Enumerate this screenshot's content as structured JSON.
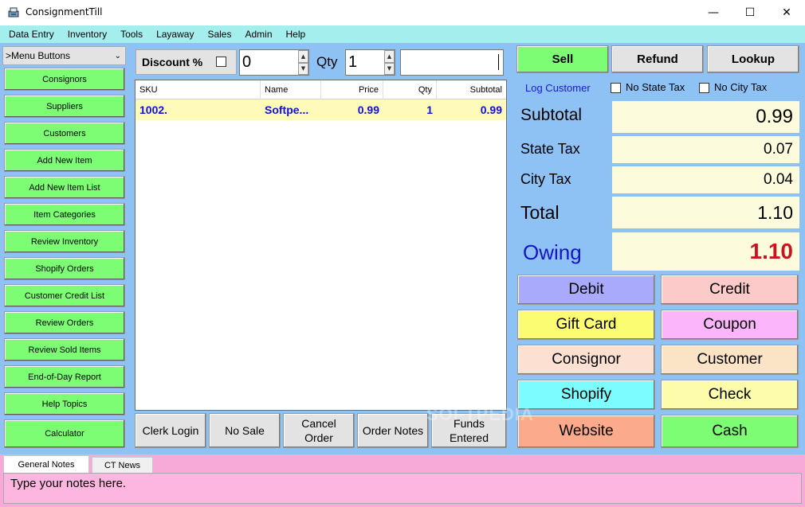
{
  "window": {
    "title": "ConsignmentTill",
    "minimize": "—",
    "maximize": "☐",
    "close": "✕"
  },
  "menu": [
    "Data Entry",
    "Inventory",
    "Tools",
    "Layaway",
    "Sales",
    "Admin",
    "Help"
  ],
  "left": {
    "dropdown_label": ">Menu Buttons",
    "buttons": [
      "Consignors",
      "Suppliers",
      "Customers",
      "Add New Item",
      "Add New Item List",
      "Item Categories",
      "Review Inventory",
      "Shopify Orders",
      "Customer Credit List",
      "Review Orders",
      "Review Sold Items",
      "End-of-Day Report",
      "Help Topics",
      "Calculator"
    ],
    "button_color": "#7dfd74"
  },
  "center": {
    "discount_label": "Discount %",
    "discount_value": "0",
    "qty_label": "Qty",
    "qty_value": "1",
    "grid": {
      "headers": [
        "SKU",
        "Name",
        "Price",
        "Qty",
        "Subtotal"
      ],
      "rows": [
        {
          "sku": "1002.",
          "name": "Softpe...",
          "price": "0.99",
          "qty": "1",
          "subtotal": "0.99"
        }
      ]
    },
    "bottom_buttons": [
      "Clerk Login",
      "No Sale",
      "Cancel Order",
      "Order Notes",
      "Funds Entered"
    ]
  },
  "right": {
    "sell": "Sell",
    "refund": "Refund",
    "lookup": "Lookup",
    "log_customer": "Log Customer",
    "no_state_tax": "No State Tax",
    "no_city_tax": "No City Tax",
    "subtotal_label": "Subtotal",
    "subtotal_value": "0.99",
    "state_tax_label": "State Tax",
    "state_tax_value": "0.07",
    "city_tax_label": "City Tax",
    "city_tax_value": "0.04",
    "total_label": "Total",
    "total_value": "1.10",
    "owing_label": "Owing",
    "owing_value": "1.10",
    "payments": [
      {
        "label": "Debit",
        "color": "#aaaafc"
      },
      {
        "label": "Credit",
        "color": "#fdcaca"
      },
      {
        "label": "Gift Card",
        "color": "#fcfc72"
      },
      {
        "label": "Coupon",
        "color": "#fbb5fb"
      },
      {
        "label": "Consignor",
        "color": "#fce0d2"
      },
      {
        "label": "Customer",
        "color": "#fbe3c5"
      },
      {
        "label": "Shopify",
        "color": "#7cfcfc"
      },
      {
        "label": "Check",
        "color": "#fcfcab"
      },
      {
        "label": "Website",
        "color": "#fcaa8c"
      },
      {
        "label": "Cash",
        "color": "#7dfd74"
      }
    ]
  },
  "notes": {
    "tab_general": "General Notes",
    "tab_news": "CT News",
    "placeholder": "Type your notes here."
  },
  "watermark": "SOFTPEDIA"
}
